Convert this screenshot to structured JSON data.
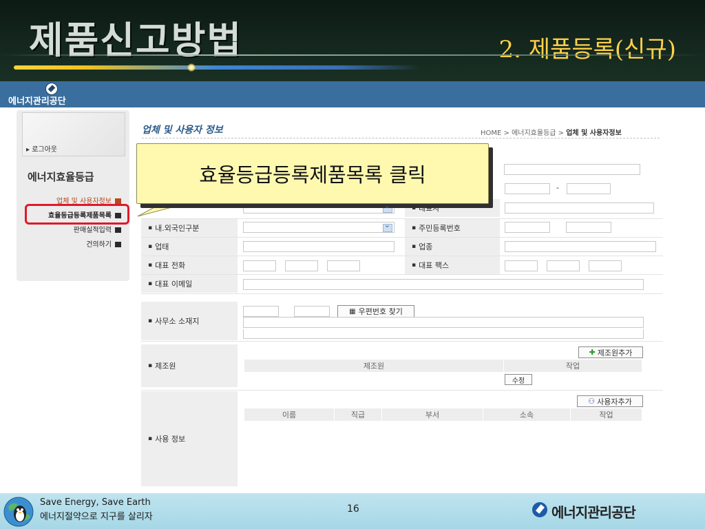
{
  "slide": {
    "title": "제품신고방법",
    "subtitle": "2. 제품등록(신규)",
    "page_number": "16"
  },
  "app": {
    "logo_text": "에너지관리공단"
  },
  "sidebar": {
    "logout_label": "▸ 로그아웃",
    "menu_title": "에너지효율등급",
    "items": [
      {
        "label": "업체 및 사용자정보"
      },
      {
        "label": "효율등급등록제품목록"
      },
      {
        "label": "판매실적입력"
      },
      {
        "label": "건의하기"
      }
    ]
  },
  "content": {
    "section_title": "업체 및 사용자 정보",
    "breadcrumb_prefix": "HOME > 에너지효율등급 > ",
    "breadcrumb_current": "업체 및 사용자정보",
    "form": {
      "dash": "-",
      "label_representative": "대표자",
      "label_citizen_type": "내.외국인구분",
      "label_resident_no": "주민등록번호",
      "label_business_type": "업태",
      "label_business_item": "업종",
      "label_phone": "대표 전화",
      "label_fax": "대표 팩스",
      "label_email": "대표 이메일",
      "label_office_address": "사무소 소재지",
      "zipcode_button": "우편번호 찾기",
      "label_manufacturer": "제조원",
      "add_manufacturer_button": "제조원추가",
      "manufacturer_table_headers": [
        "제조원",
        "작업"
      ],
      "edit_button": "수정",
      "label_user_info": "사용 정보",
      "add_user_button": "사용자추가",
      "user_table_headers": [
        "이름",
        "직급",
        "부서",
        "소속",
        "작업"
      ]
    }
  },
  "callout": {
    "text": "효율등급등록제품목록 클릭"
  },
  "footer": {
    "line1": "Save Energy, Save Earth",
    "line2": "에너지절약으로 지구를 살리자",
    "logo_text": "에너지관리공단"
  },
  "colors": {
    "header_bg": "#14271e",
    "subtitle": "#ffd24a",
    "appbar": "#3a6e9e",
    "callout_bg": "#fff9b0",
    "highlight_box": "#e0182a",
    "footer_bg": "#a6d7e6"
  }
}
